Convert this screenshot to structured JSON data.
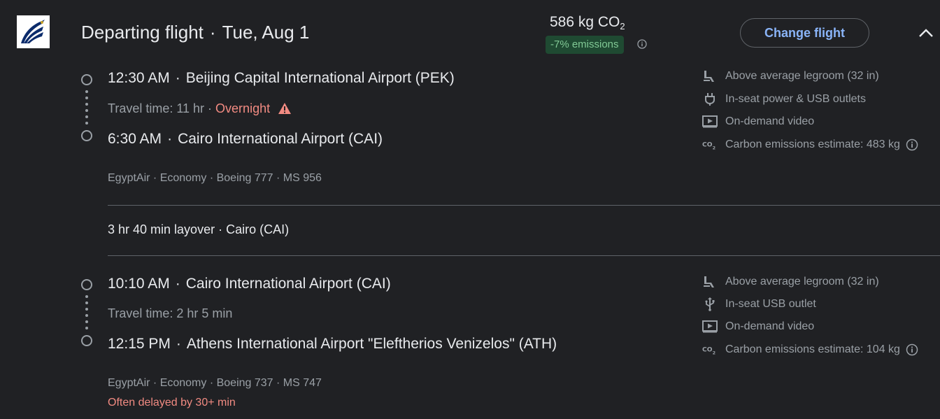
{
  "header": {
    "title": "Departing flight",
    "date": "Tue, Aug 1",
    "co2_value": "586 kg CO",
    "co2_sub": "2",
    "emissions_badge": "-7% emissions",
    "change_flight_label": "Change flight"
  },
  "segments": [
    {
      "dep_time": "12:30 AM",
      "dep_airport": "Beijing Capital International Airport (PEK)",
      "travel_time": "Travel time: 11 hr",
      "overnight": "Overnight",
      "arr_time": "6:30 AM",
      "arr_airport": "Cairo International Airport (CAI)",
      "meta": "EgyptAir · Economy · Boeing 777 · MS 956",
      "amenities": [
        {
          "icon": "legroom-icon",
          "label": "Above average legroom (32 in)"
        },
        {
          "icon": "power-plug-icon",
          "label": "In-seat power & USB outlets"
        },
        {
          "icon": "video-icon",
          "label": "On-demand video"
        },
        {
          "icon": "co2-icon",
          "label": "Carbon emissions estimate: 483 kg"
        }
      ]
    },
    {
      "dep_time": "10:10 AM",
      "dep_airport": "Cairo International Airport (CAI)",
      "travel_time": "Travel time: 2 hr 5 min",
      "arr_time": "12:15 PM",
      "arr_airport": "Athens International Airport \"Eleftherios Venizelos\" (ATH)",
      "meta": "EgyptAir · Economy · Boeing 737 · MS 747",
      "delay": "Often delayed by 30+ min",
      "amenities": [
        {
          "icon": "legroom-icon",
          "label": "Above average legroom (32 in)"
        },
        {
          "icon": "usb-icon",
          "label": "In-seat USB outlet"
        },
        {
          "icon": "video-icon",
          "label": "On-demand video"
        },
        {
          "icon": "co2-icon",
          "label": "Carbon emissions estimate: 104 kg"
        }
      ]
    }
  ],
  "layover": "3 hr 40 min layover · Cairo (CAI)",
  "colors": {
    "background": "#202124",
    "accent": "#8ab4f8",
    "warning": "#f28b82",
    "positive": "#81c995"
  }
}
